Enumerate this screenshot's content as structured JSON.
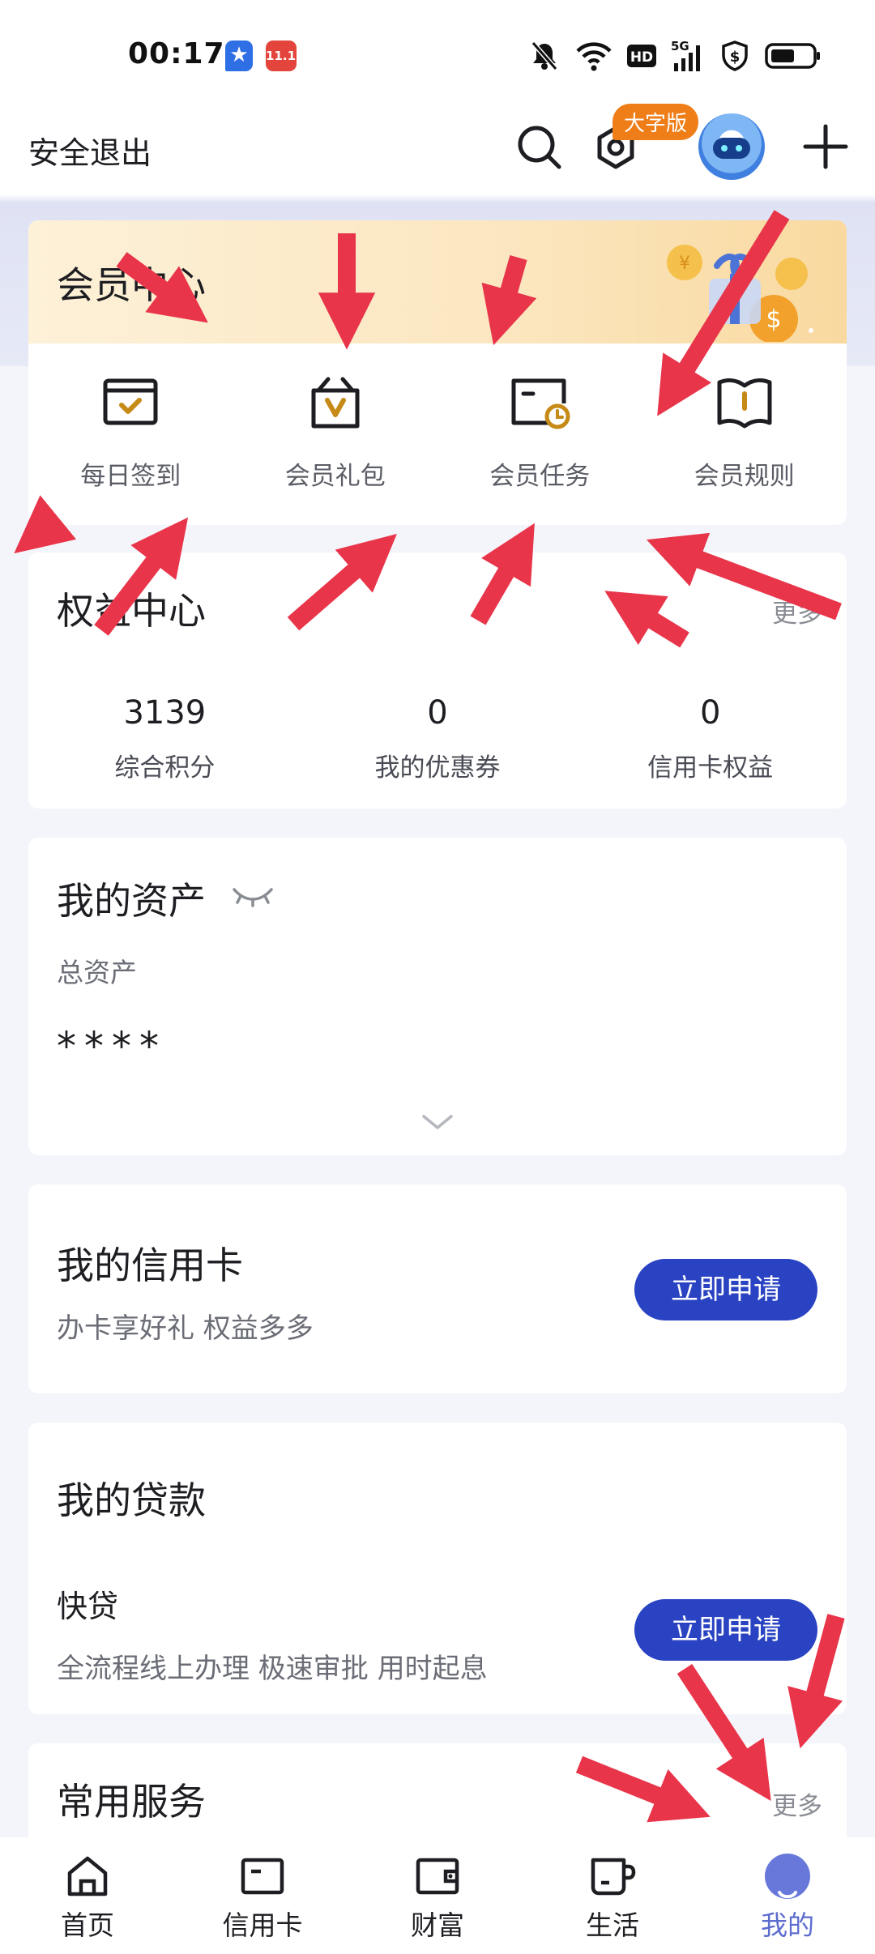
{
  "status_bar": {
    "time": "00:17",
    "notif_icons": [
      "assistant-app-icon",
      "shopping-app-icon"
    ],
    "notif_icon_2_text": "11.11",
    "network": "5G",
    "hd": "HD"
  },
  "header": {
    "logout": "安全退出",
    "big_font_badge": "大字版"
  },
  "member_center": {
    "title": "会员中心",
    "items": [
      {
        "label": "每日签到",
        "icon": "calendar-check-icon"
      },
      {
        "label": "会员礼包",
        "icon": "gift-bag-icon"
      },
      {
        "label": "会员任务",
        "icon": "task-clock-icon"
      },
      {
        "label": "会员规则",
        "icon": "rules-book-icon"
      }
    ]
  },
  "rights_center": {
    "title": "权益中心",
    "more": "更多",
    "stats": [
      {
        "value": "3139",
        "label": "综合积分"
      },
      {
        "value": "0",
        "label": "我的优惠券"
      },
      {
        "value": "0",
        "label": "信用卡权益"
      }
    ]
  },
  "assets": {
    "title": "我的资产",
    "label": "总资产",
    "value": "****"
  },
  "credit_card": {
    "title": "我的信用卡",
    "subtitle": "办卡享好礼 权益多多",
    "button": "立即申请"
  },
  "loan": {
    "title": "我的贷款",
    "product": "快贷",
    "description": "全流程线上办理 极速审批 用时起息",
    "button": "立即申请"
  },
  "services": {
    "title": "常用服务",
    "more": "更多"
  },
  "bottom_nav": [
    {
      "label": "首页",
      "icon": "home-icon"
    },
    {
      "label": "信用卡",
      "icon": "credit-card-icon"
    },
    {
      "label": "财富",
      "icon": "wallet-icon"
    },
    {
      "label": "生活",
      "icon": "cup-icon"
    },
    {
      "label": "我的",
      "icon": "profile-icon",
      "active": true
    }
  ],
  "colors": {
    "primary_button": "#2a43c2",
    "active_tab": "#5c6ccf",
    "accent_orange": "#ef7d18",
    "member_icon_accent": "#c68a16",
    "annotation_arrow": "#e8354a"
  }
}
